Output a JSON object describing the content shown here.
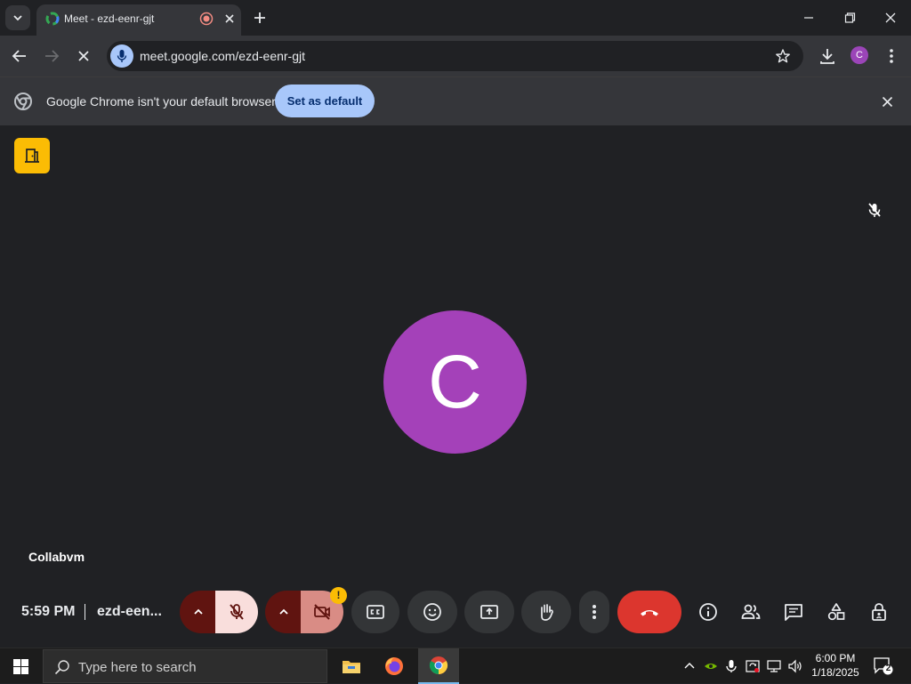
{
  "browser": {
    "tab_title": "Meet - ezd-eenr-gjt",
    "url_host": "meet.google.com",
    "url_path": "/ezd-eenr-gjt",
    "profile_initial": "C",
    "infobar": {
      "message": "Google Chrome isn't your default browser",
      "button": "Set as default"
    }
  },
  "meet": {
    "avatar_initial": "C",
    "participant_name": "Collabvm",
    "time": "5:59 PM",
    "meeting_code": "ezd-een...",
    "camera_warning": "!",
    "colors": {
      "avatar": "#a441b9",
      "end_call": "#dc362e",
      "door_button": "#fbbc04"
    }
  },
  "taskbar": {
    "search_placeholder": "Type here to search",
    "time": "6:00 PM",
    "date": "1/18/2025",
    "notification_count": "2"
  }
}
